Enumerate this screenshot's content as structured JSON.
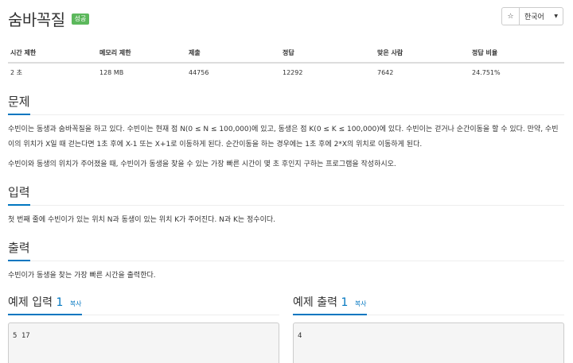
{
  "problem": {
    "title": "숨바꼭질",
    "status_badge": "성공",
    "language": "한국어",
    "star_icon": "☆"
  },
  "stats": {
    "headers": [
      "시간 제한",
      "메모리 제한",
      "제출",
      "정답",
      "맞은 사람",
      "정답 비율"
    ],
    "values": [
      "2 초",
      "128 MB",
      "44756",
      "12292",
      "7642",
      "24.751%"
    ]
  },
  "sections": {
    "problem_heading": "문제",
    "problem_p1": "수빈이는 동생과 숨바꼭질을 하고 있다. 수빈이는 현재 점 N(0 ≤ N ≤ 100,000)에 있고, 동생은 점 K(0 ≤ K ≤ 100,000)에 있다. 수빈이는 걷거나 순간이동을 할 수 있다. 만약, 수빈이의 위치가 X일 때 걷는다면 1초 후에 X-1 또는 X+1로 이동하게 된다. 순간이동을 하는 경우에는 1초 후에 2*X의 위치로 이동하게 된다.",
    "problem_p2": "수빈이와 동생의 위치가 주어졌을 때, 수빈이가 동생을 찾을 수 있는 가장 빠른 시간이 몇 초 후인지 구하는 프로그램을 작성하시오.",
    "input_heading": "입력",
    "input_text": "첫 번째 줄에 수빈이가 있는 위치 N과 동생이 있는 위치 K가 주어진다. N과 K는 정수이다.",
    "output_heading": "출력",
    "output_text": "수빈이가 동생을 찾는 가장 빠른 시간을 출력한다."
  },
  "samples": {
    "input_label": "예제 입력",
    "input_num": "1",
    "output_label": "예제 출력",
    "output_num": "1",
    "copy_label": "복사",
    "input_value": "5 17",
    "output_value": "4"
  }
}
